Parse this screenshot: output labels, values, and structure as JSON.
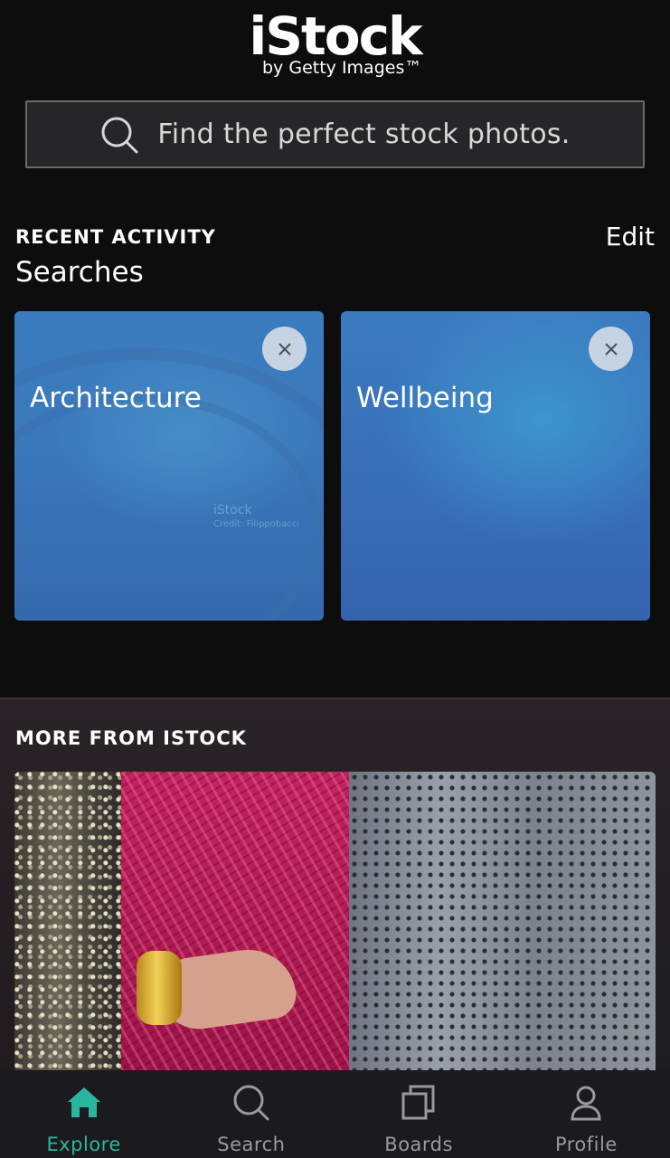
{
  "app": {
    "logo_main": "iStock",
    "logo_sub": "by Getty Images™"
  },
  "search": {
    "placeholder": "Find the perfect stock photos."
  },
  "recent_activity": {
    "title": "RECENT ACTIVITY",
    "edit_label": "Edit",
    "subtitle": "Searches",
    "cards": [
      {
        "label": "Architecture",
        "watermark": "iStock",
        "watermark_credit": "Credit: Filippobacci"
      },
      {
        "label": "Wellbeing"
      }
    ]
  },
  "more": {
    "title": "MORE FROM ISTOCK"
  },
  "tabs": [
    {
      "label": "Explore",
      "icon": "home-icon",
      "active": true
    },
    {
      "label": "Search",
      "icon": "search-icon",
      "active": false
    },
    {
      "label": "Boards",
      "icon": "boards-icon",
      "active": false
    },
    {
      "label": "Profile",
      "icon": "profile-icon",
      "active": false
    }
  ],
  "colors": {
    "background": "#0d0d0e",
    "active_tab": "#2bb5a0",
    "inactive_tab": "#9a9a9c",
    "card_blue": "#3a78bb"
  }
}
